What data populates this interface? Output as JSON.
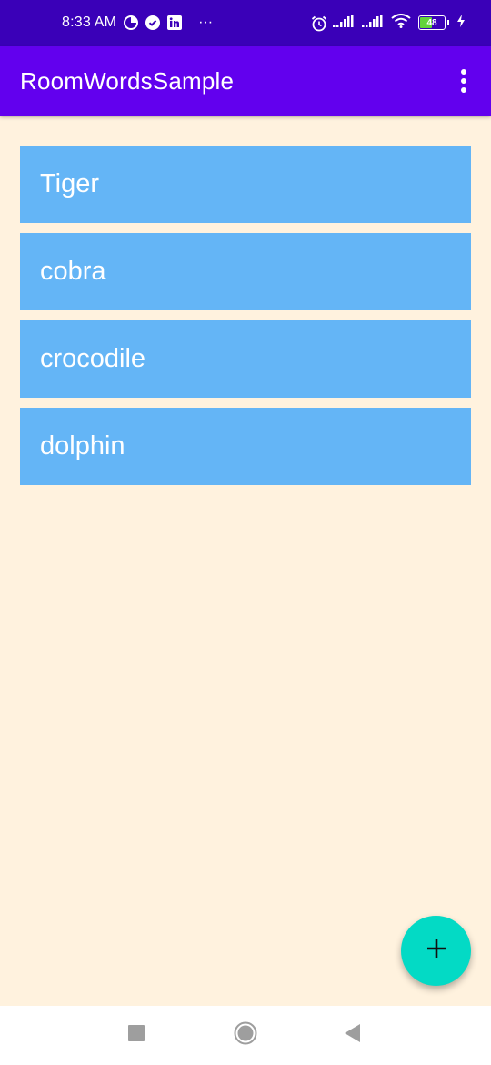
{
  "status_bar": {
    "time": "8:33 AM",
    "left_icons": [
      "data-saver-icon",
      "check-circle-icon",
      "linkedin-icon"
    ],
    "more_indicator": "···",
    "battery_level": "48",
    "right_icons": [
      "alarm-icon",
      "signal-icon",
      "signal-icon",
      "wifi-icon",
      "battery-icon",
      "charging-icon"
    ]
  },
  "app_bar": {
    "title": "RoomWordsSample",
    "menu_icon": "overflow-menu-icon"
  },
  "words": [
    {
      "label": "Tiger"
    },
    {
      "label": "cobra"
    },
    {
      "label": "crocodile"
    },
    {
      "label": "dolphin"
    }
  ],
  "fab": {
    "icon": "plus-icon"
  },
  "nav_bar": {
    "buttons": [
      "recents-icon",
      "home-icon",
      "back-icon"
    ]
  },
  "colors": {
    "status_bar": "#3A00B8",
    "app_bar": "#6200EE",
    "background": "#FFF2DE",
    "item": "#64B5F6",
    "fab": "#03DAC5"
  }
}
